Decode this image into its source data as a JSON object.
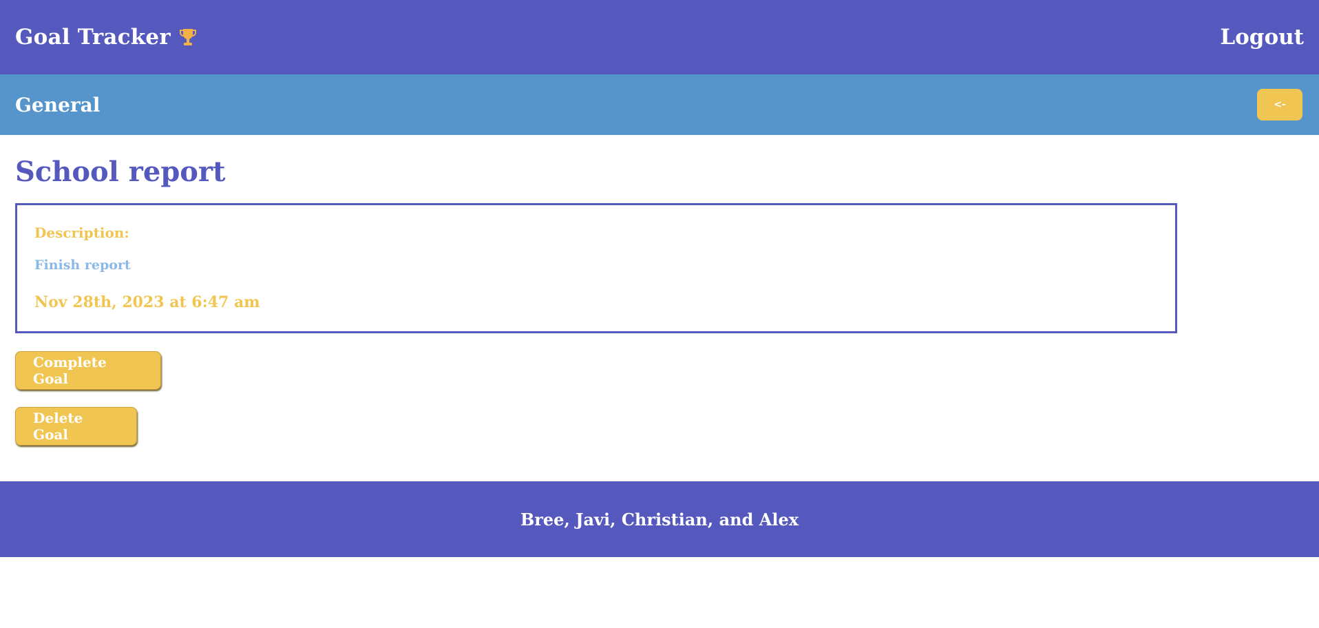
{
  "header": {
    "app_title": "Goal Tracker",
    "brand_icon": "trophy-icon",
    "logout_label": "Logout"
  },
  "subheader": {
    "category": "General",
    "back_label": "<-"
  },
  "goal": {
    "title": "School report",
    "description_label": "Description:",
    "description": "Finish report",
    "date": "Nov 28th, 2023 at 6:47 am"
  },
  "actions": {
    "complete_label": "Complete Goal",
    "delete_label": "Delete Goal"
  },
  "footer": {
    "credits": "Bree, Javi, Christian, and Alex"
  },
  "colors": {
    "primary": "#5559bd",
    "secondary": "#5595cb",
    "accent": "#f1c551",
    "light_blue_text": "#8ab8e8"
  }
}
